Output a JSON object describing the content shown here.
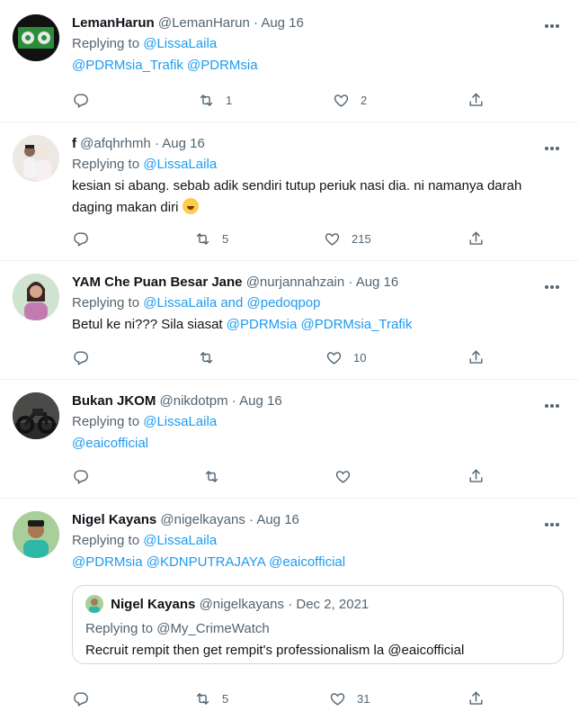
{
  "tweets": [
    {
      "name": "LemanHarun",
      "handle": "@LemanHarun",
      "date": "Aug 16",
      "replying_prefix": "Replying to ",
      "replying_to": "@LissaLaila",
      "mentions": "@PDRMsia_Trafik @PDRMsia",
      "text": "",
      "retweets": "1",
      "likes": "2"
    },
    {
      "name": "f",
      "handle": "@afqhrhmh",
      "date": "Aug 16",
      "replying_prefix": "Replying to ",
      "replying_to": "@LissaLaila",
      "text_line1": "kesian si abang. sebab adik sendiri tutup periuk nasi dia. ni namanya darah",
      "text_line2": "daging makan diri",
      "emoji": "shushing-face",
      "retweets": "5",
      "likes": "215"
    },
    {
      "name": "YAM Che Puan Besar Jane",
      "handle": "@nurjannahzain",
      "date": "Aug 16",
      "replying_prefix": "Replying to ",
      "replying_to": "@LissaLaila and @pedoqpop",
      "text": "Betul ke ni??? Sila siasat ",
      "text_mentions": "@PDRMsia @PDRMsia_Trafik",
      "retweets": "",
      "likes": "10"
    },
    {
      "name": "Bukan JKOM",
      "handle": "@nikdotpm",
      "date": "Aug 16",
      "replying_prefix": "Replying to ",
      "replying_to": "@LissaLaila",
      "mentions": "@eaicofficial",
      "retweets": "",
      "likes": ""
    },
    {
      "name": "Nigel Kayans",
      "handle": "@nigelkayans",
      "date": "Aug 16",
      "replying_prefix": "Replying to ",
      "replying_to": "@LissaLaila",
      "mentions": "@PDRMsia @KDNPUTRAJAYA @eaicofficial",
      "quote": {
        "name": "Nigel Kayans",
        "handle": "@nigelkayans",
        "date": "Dec 2, 2021",
        "replying": "Replying to @My_CrimeWatch",
        "text": "Recruit rempit then get rempit's professionalism la @eaicofficial"
      },
      "retweets": "5",
      "likes": "31"
    }
  ],
  "separator": "·",
  "colors": {
    "accent": "#1d9bf0",
    "secondary_text": "#536471",
    "divider": "#eff3f4"
  },
  "icons": [
    "reply-icon",
    "retweet-icon",
    "like-icon",
    "share-icon",
    "more-icon"
  ]
}
